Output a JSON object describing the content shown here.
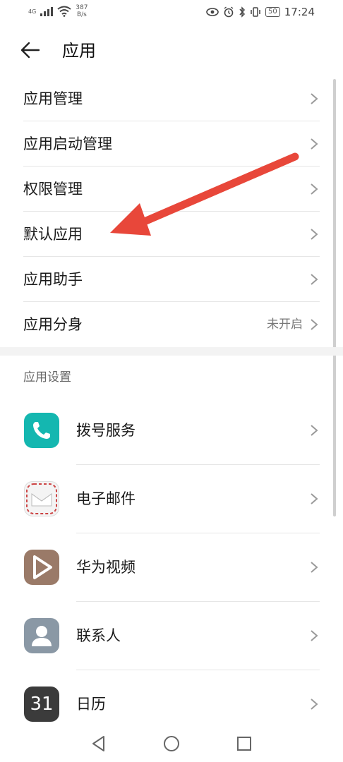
{
  "status_bar": {
    "network_tag": "4G",
    "speed_value": "387",
    "speed_unit": "B/s",
    "battery": "50",
    "time": "17:24"
  },
  "header": {
    "title": "应用"
  },
  "menu": [
    {
      "label": "应用管理",
      "value": ""
    },
    {
      "label": "应用启动管理",
      "value": ""
    },
    {
      "label": "权限管理",
      "value": ""
    },
    {
      "label": "默认应用",
      "value": ""
    },
    {
      "label": "应用助手",
      "value": ""
    },
    {
      "label": "应用分身",
      "value": "未开启"
    }
  ],
  "section": {
    "title": "应用设置"
  },
  "apps": [
    {
      "label": "拨号服务",
      "icon": "phone-icon"
    },
    {
      "label": "电子邮件",
      "icon": "email-icon"
    },
    {
      "label": "华为视频",
      "icon": "video-icon"
    },
    {
      "label": "联系人",
      "icon": "contacts-icon"
    },
    {
      "label": "日历",
      "icon": "calendar-icon",
      "icon_text": "31"
    }
  ],
  "colors": {
    "annotation_arrow": "#e8473a",
    "dialer": "#14b7b0",
    "video": "#9a7a68",
    "contacts": "#8a98a5",
    "calendar": "#3b3b3b"
  }
}
